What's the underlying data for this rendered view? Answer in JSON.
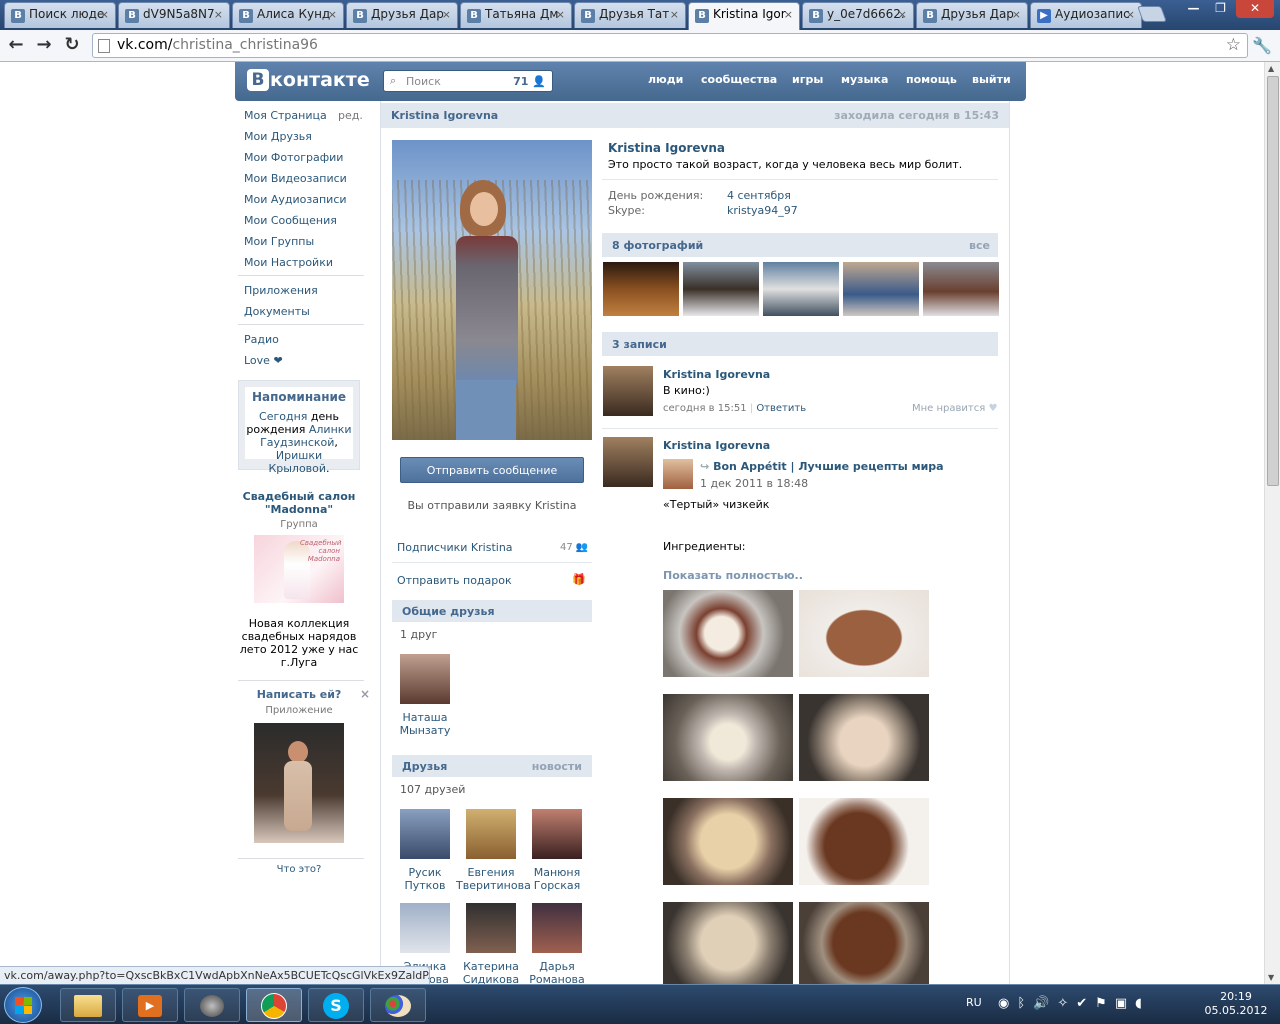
{
  "browser": {
    "tabs": [
      {
        "label": "Поиск люде",
        "active": false
      },
      {
        "label": "dV9N5a8N7",
        "active": false
      },
      {
        "label": "Алиса Кунд",
        "active": false
      },
      {
        "label": "Друзья Дар",
        "active": false
      },
      {
        "label": "Татьяна Дм",
        "active": false
      },
      {
        "label": "Друзья Тат",
        "active": false
      },
      {
        "label": "Kristina Igor",
        "active": true
      },
      {
        "label": "y_0e7d6662.",
        "active": false
      },
      {
        "label": "Друзья Дар",
        "active": false
      },
      {
        "label": "Аудиозапис",
        "active": false
      }
    ],
    "url_host": "vk.com/",
    "url_path": "christina_christina96",
    "status_url": "vk.com/away.php?to=QxscBkBxC1VwdApbXnNeAx5BCUETcQscGlVkEx9ZaldP..."
  },
  "vk": {
    "logo": "контакте",
    "logo_b": "В",
    "search_placeholder": "Поиск",
    "search_count": "71",
    "nav": [
      "люди",
      "сообщества",
      "игры",
      "музыка",
      "помощь",
      "выйти"
    ]
  },
  "menu": {
    "items": [
      "Моя Страница",
      "Мои Друзья",
      "Мои Фотографии",
      "Мои Видеозаписи",
      "Мои Аудиозаписи",
      "Мои Сообщения",
      "Мои Группы",
      "Мои Настройки"
    ],
    "edit": "ред.",
    "apps": [
      "Приложения",
      "Документы"
    ],
    "extra": [
      "Радио",
      "Love ❤"
    ]
  },
  "reminder": {
    "title": "Напоминание",
    "text_link1": "Сегодня",
    "text1": " день рождения ",
    "text_link2": "Алинки Гаудзинской",
    "text2": ", ",
    "text_link3": "Иришки Крыловой",
    "text3": "."
  },
  "ad": {
    "title": "Свадебный салон \"Madonna\"",
    "sub": "Группа",
    "img_text": "Свадебный салон Madonna",
    "desc": "Новая коллекция свадебных нарядов лето 2012 уже у нас г.Луга"
  },
  "app_ad": {
    "title": "Написать ей?",
    "sub": "Приложение",
    "footer": "Что это?"
  },
  "profile": {
    "name_header": "Kristina Igorevna",
    "last_seen": "заходила сегодня в 15:43",
    "name": "Kristina Igorevna",
    "status": "Это просто такой возраст, когда у человека весь мир болит.",
    "fields": [
      {
        "label": "День рождения:",
        "value": "4 сентября"
      },
      {
        "label": "Skype:",
        "value": "kristya94_97"
      }
    ],
    "send_button": "Отправить сообщение",
    "request_note": "Вы отправили заявку Kristina",
    "subscribers_label": "Подписчики Kristina",
    "subscribers_count": "47",
    "gift_label": "Отправить подарок",
    "common_friends_title": "Общие друзья",
    "common_friends_count": "1 друг",
    "common_friends": [
      {
        "first": "Наташа",
        "last": "Мынзату"
      }
    ],
    "friends_title": "Друзья",
    "friends_news": "новости",
    "friends_count": "107 друзей",
    "friends": [
      {
        "first": "Русик",
        "last": "Путков"
      },
      {
        "first": "Евгения",
        "last": "Тверитинова"
      },
      {
        "first": "Манюня",
        "last": "Горская"
      },
      {
        "first": "Элинка",
        "last": "Листова"
      },
      {
        "first": "Катерина",
        "last": "Сидикова"
      },
      {
        "first": "Дарья",
        "last": "Романова"
      }
    ],
    "photos_title": "8 фотографий",
    "photos_all": "все",
    "wall_title": "3 записи",
    "posts": [
      {
        "author": "Kristina Igorevna",
        "text": "В кино:)",
        "time": "сегодня в 15:51",
        "reply": "Ответить",
        "like": "Мне нравится"
      },
      {
        "author": "Kristina Igorevna",
        "repost_from": "Bon Appétit | Лучшие рецепты мира",
        "repost_time": "1 дек 2011 в 18:48",
        "text": "«Тертый» чизкейк",
        "text2": "Ингредиенты:",
        "more": "Показать полностью.."
      }
    ]
  },
  "taskbar": {
    "lang": "RU",
    "time": "20:19",
    "date": "05.05.2012"
  },
  "colors": {
    "vk_blue": "#45688e",
    "link": "#2b587a",
    "header_bg": "#e1e7ee"
  }
}
